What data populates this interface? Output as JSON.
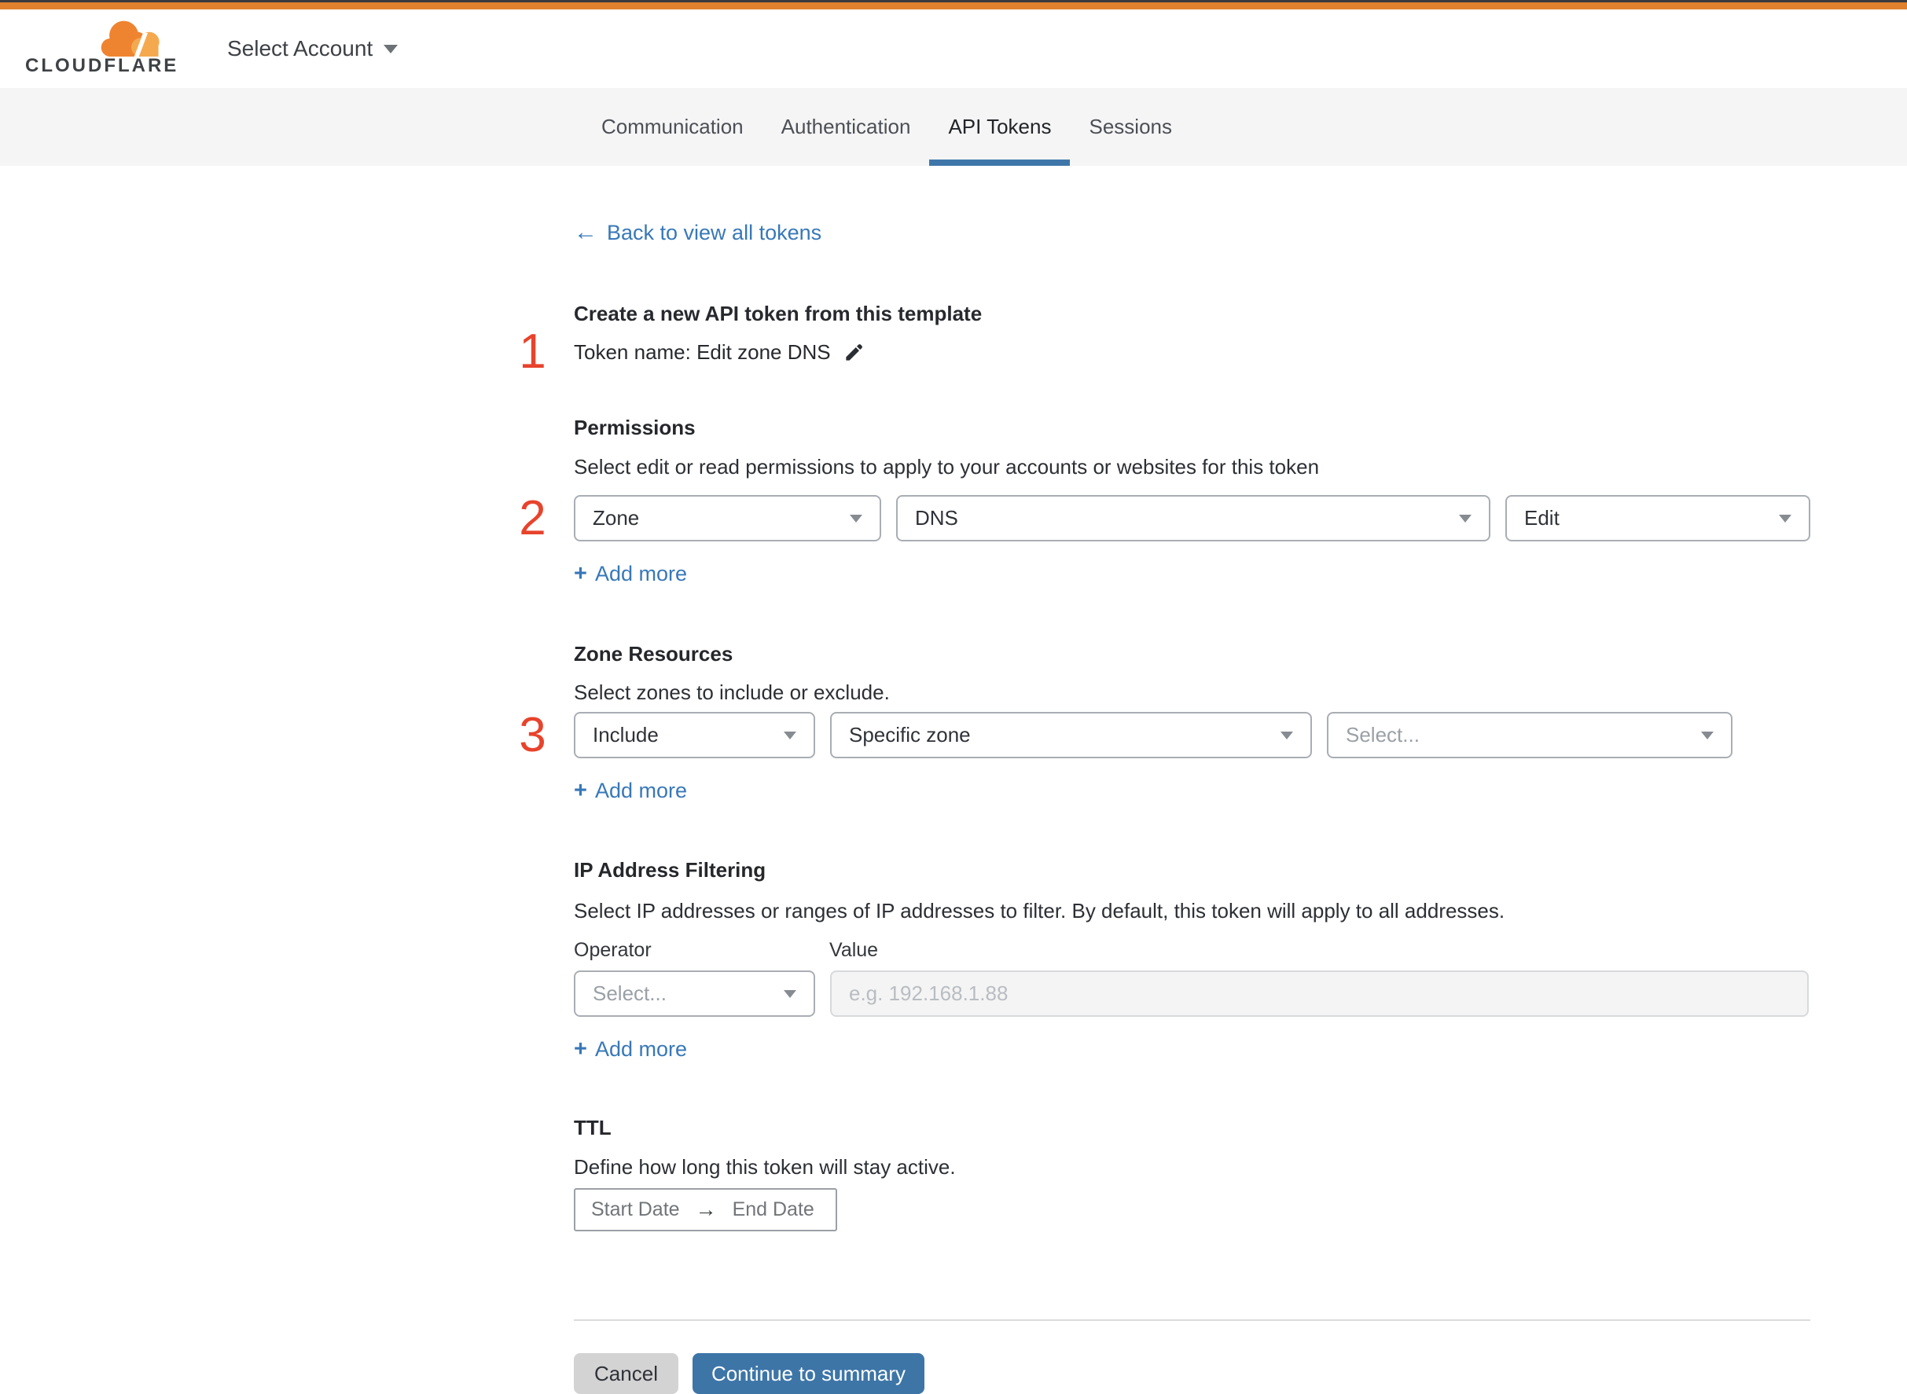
{
  "colors": {
    "brand_orange": "#e0812d",
    "link_blue": "#3878b8",
    "action_blue": "#3d75a7",
    "active_tab_underline": "#3f76a9",
    "step_red": "#e8432c"
  },
  "icons": {
    "back_arrow": "←",
    "plus": "+",
    "range_arrow": "→"
  },
  "header": {
    "logo_wordmark": "CLOUDFLARE",
    "account_selector_label": "Select Account"
  },
  "tabs": [
    {
      "label": "Communication",
      "active": false
    },
    {
      "label": "Authentication",
      "active": false
    },
    {
      "label": "API Tokens",
      "active": true
    },
    {
      "label": "Sessions",
      "active": false
    }
  ],
  "back_link_label": "Back to view all tokens",
  "template_intro": {
    "step": "1",
    "title": "Create a new API token from this template",
    "token_name_line": "Token name: Edit zone DNS"
  },
  "permissions": {
    "step": "2",
    "title": "Permissions",
    "description": "Select edit or read permissions to apply to your accounts or websites for this token",
    "scope_select_value": "Zone",
    "service_select_value": "DNS",
    "access_select_value": "Edit",
    "add_more_label": "Add more"
  },
  "zone_resources": {
    "step": "3",
    "title": "Zone Resources",
    "description": "Select zones to include or exclude.",
    "operator_select_value": "Include",
    "type_select_value": "Specific zone",
    "zone_select_placeholder": "Select...",
    "add_more_label": "Add more"
  },
  "ip_filtering": {
    "title": "IP Address Filtering",
    "description": "Select IP addresses or ranges of IP addresses to filter. By default, this token will apply to all addresses.",
    "operator_label": "Operator",
    "value_label": "Value",
    "operator_select_placeholder": "Select...",
    "value_placeholder": "e.g. 192.168.1.88",
    "add_more_label": "Add more"
  },
  "ttl": {
    "title": "TTL",
    "description": "Define how long this token will stay active.",
    "start_label": "Start Date",
    "end_label": "End Date"
  },
  "footer": {
    "cancel_label": "Cancel",
    "continue_label": "Continue to summary"
  }
}
